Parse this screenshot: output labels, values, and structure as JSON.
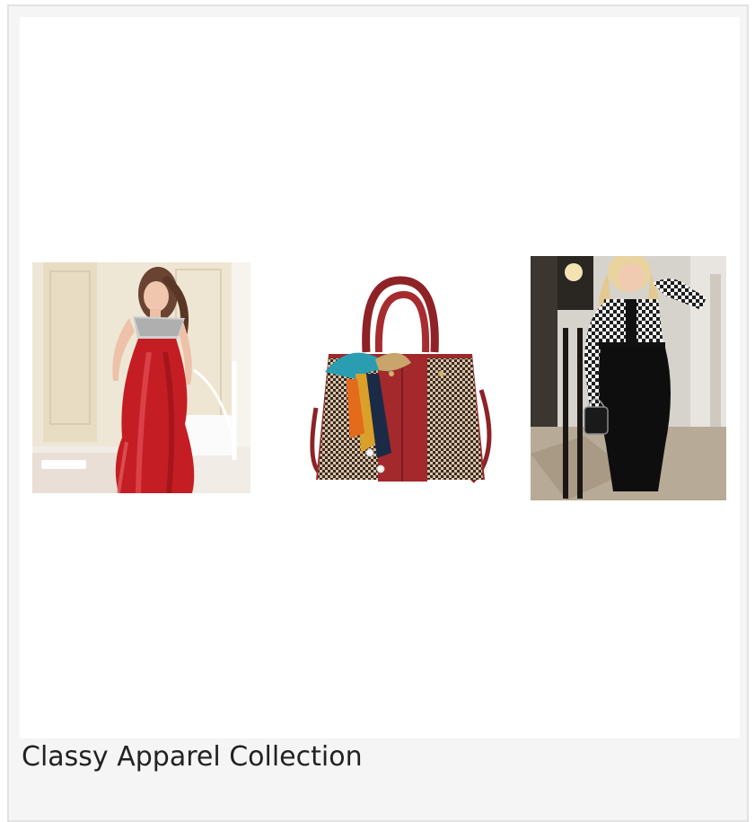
{
  "collection": {
    "title": "Classy Apparel Collection",
    "products": [
      {
        "icon": "red-satin-nightgown-photo"
      },
      {
        "icon": "red-houndstooth-handbag-photo"
      },
      {
        "icon": "houndstooth-blouse-black-skirt-photo"
      }
    ]
  },
  "colors": {
    "card_bg": "#f5f5f5",
    "card_border": "#e2e2e2",
    "image_bg": "#ffffff",
    "satin_red": "#c41e24",
    "bag_red": "#9b2a2d",
    "text": "#222222"
  }
}
